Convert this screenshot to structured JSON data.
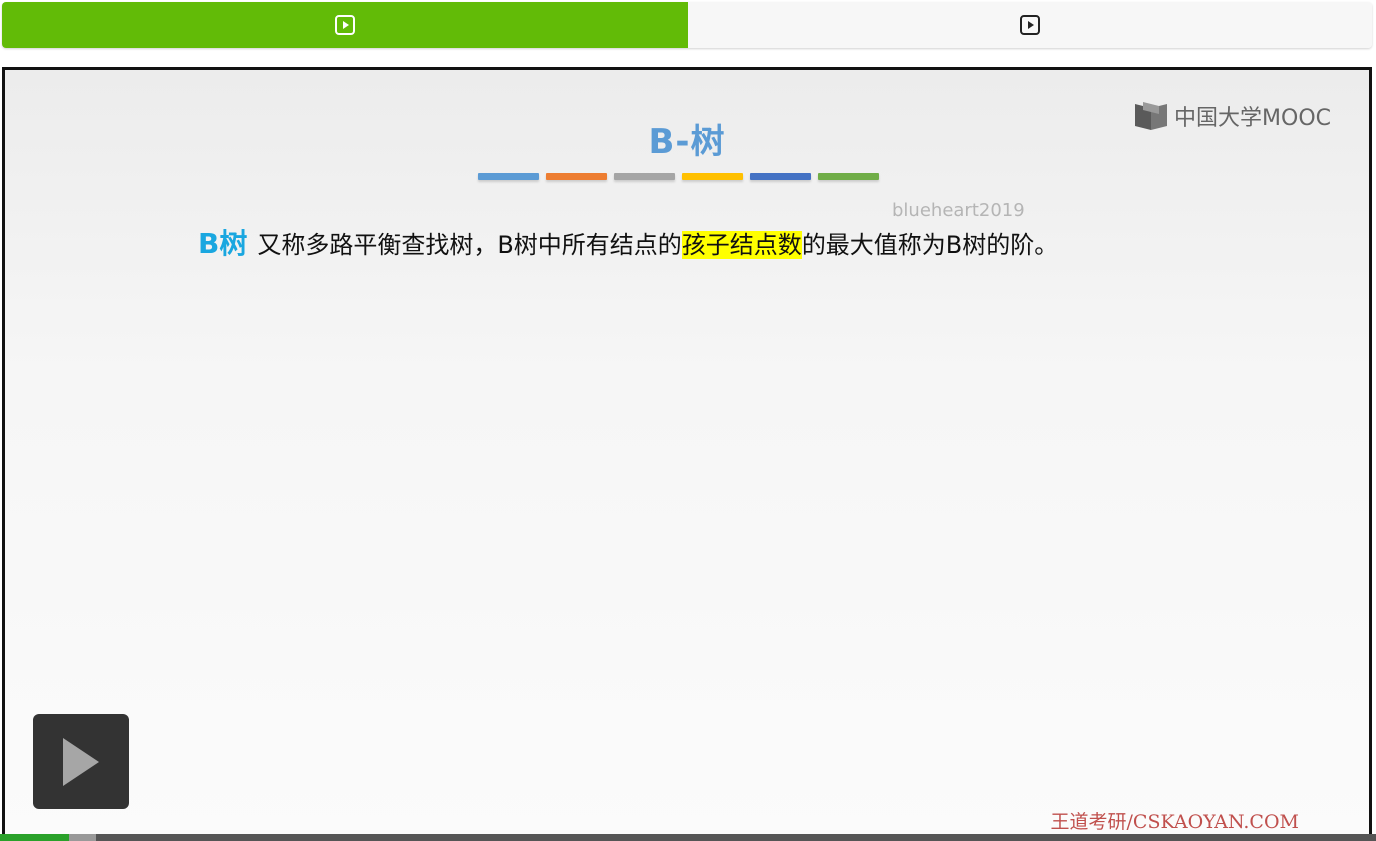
{
  "tabs": [
    {
      "icon": "play-square-icon",
      "active": true
    },
    {
      "icon": "play-square-icon",
      "active": false
    }
  ],
  "colors": {
    "tab_active": "#62bb07",
    "tab_inactive": "#f7f7f7",
    "title": "#5b9bd5",
    "term": "#1aa7e0",
    "highlight": "#ffff00",
    "credit": "#c0504d",
    "progress_played": "#2aa12a"
  },
  "slide": {
    "title": "B-树",
    "underline_colors": [
      "#5b9bd5",
      "#ed7d31",
      "#a5a5a5",
      "#ffc000",
      "#4472c4",
      "#70ad47"
    ],
    "logo_text": "中国大学MOOC",
    "watermark": "blueheart2019",
    "definition": {
      "term": "B树",
      "before": "又称多路平衡查找树，B树中所有结点的",
      "highlight": "孩子结点数",
      "after": "的最大值称为B树的阶。"
    },
    "credit": "王道考研/CSKAOYAN.COM"
  },
  "player": {
    "play_icon": "play-icon",
    "progress_fraction": 0.05,
    "buffered_fraction": 0.07
  }
}
